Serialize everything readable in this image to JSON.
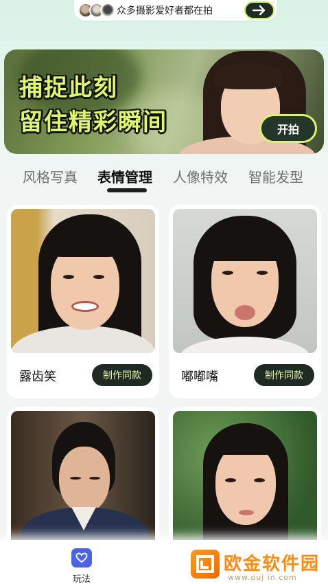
{
  "promo_pill": {
    "text": "众多摄影爱好者都在拍",
    "arrow_icon": "arrow-right-icon",
    "accent": "#c7f25a"
  },
  "banner": {
    "line1": "捕捉此刻",
    "line2": "留住精彩瞬间",
    "button_label": "开拍",
    "headline_color": "#dff76a"
  },
  "tabs": [
    {
      "label": "风格写真",
      "active": false
    },
    {
      "label": "表情管理",
      "active": true
    },
    {
      "label": "人像特效",
      "active": false
    },
    {
      "label": "智能发型",
      "active": false
    }
  ],
  "cards": [
    {
      "name": "露齿笑",
      "button": "制作同款"
    },
    {
      "name": "嘟嘟嘴",
      "button": "制作同款"
    },
    {
      "name": "",
      "button": ""
    },
    {
      "name": "",
      "button": ""
    }
  ],
  "bottom_nav": {
    "items": [
      {
        "label": "玩法",
        "icon": "heart-icon",
        "active": true,
        "color": "#4b63e6"
      }
    ]
  },
  "watermark": {
    "text": "欧金软件园",
    "sub": "www.ouj in.com"
  }
}
